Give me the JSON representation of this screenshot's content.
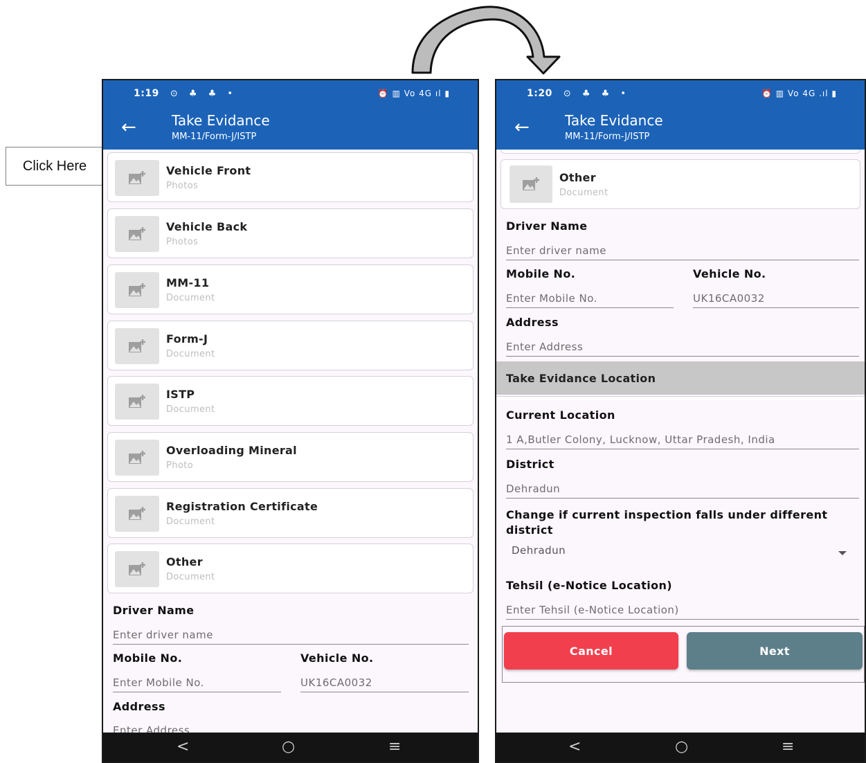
{
  "callout": {
    "text": "Click Here"
  },
  "left_screen": {
    "status": {
      "time": "1:19",
      "notifications": "⊙ ♣ ♣ •",
      "system": "⏰ ▥ Vo 4G ıl ▮"
    },
    "appbar": {
      "title": "Take Evidance",
      "subtitle": "MM-11/Form-J/ISTP"
    },
    "cards": [
      {
        "label": "Vehicle Front",
        "sub": "Photos"
      },
      {
        "label": "Vehicle Back",
        "sub": "Photos"
      },
      {
        "label": "MM-11",
        "sub": "Document"
      },
      {
        "label": "Form-J",
        "sub": "Document"
      },
      {
        "label": "ISTP",
        "sub": "Document"
      },
      {
        "label": "Overloading Mineral",
        "sub": "Photo"
      },
      {
        "label": "Registration Certificate",
        "sub": "Document"
      },
      {
        "label": "Other",
        "sub": "Document"
      }
    ],
    "driver_name_label": "Driver Name",
    "driver_name_placeholder": "Enter driver name",
    "mobile_label": "Mobile No.",
    "mobile_placeholder": "Enter Mobile No.",
    "vehicle_label": "Vehicle No.",
    "vehicle_value": "UK16CA0032",
    "address_label": "Address",
    "address_placeholder": "Enter Address"
  },
  "right_screen": {
    "status": {
      "time": "1:20",
      "notifications": "⊙ ♣ ♣ •",
      "system": "⏰ ▥ Vo 4G .ıl ▮"
    },
    "appbar": {
      "title": "Take Evidance",
      "subtitle": "MM-11/Form-J/ISTP"
    },
    "card": {
      "label": "Other",
      "sub": "Document"
    },
    "driver_name_label": "Driver Name",
    "driver_name_placeholder": "Enter driver name",
    "mobile_label": "Mobile No.",
    "mobile_placeholder": "Enter Mobile No.",
    "vehicle_label": "Vehicle No.",
    "vehicle_value": "UK16CA0032",
    "address_label": "Address",
    "address_placeholder": "Enter Address",
    "location_section": "Take Evidance Location",
    "current_location_label": "Current Location",
    "current_location_value": "1 A,Butler Colony, Lucknow, Uttar Pradesh, India",
    "district_label": "District",
    "district_value": "Dehradun",
    "change_district_label": "Change if current inspection falls under different district",
    "change_district_selected": "Dehradun",
    "tehsil_label": "Tehsil (e-Notice Location)",
    "tehsil_placeholder": "Enter Tehsil (e-Notice Location)",
    "cancel_label": "Cancel",
    "next_label": "Next"
  },
  "navbar": {
    "back": "<",
    "home": "○",
    "recents": "≡"
  },
  "icons": [
    "back-arrow-icon",
    "add-image-icon",
    "dropdown-arrow-icon",
    "curved-arrow-icon"
  ],
  "colors": {
    "appbar": "#1c63b8",
    "cancel": "#f23f4d",
    "next": "#5d7f89",
    "section_band": "#c7c7c7"
  }
}
